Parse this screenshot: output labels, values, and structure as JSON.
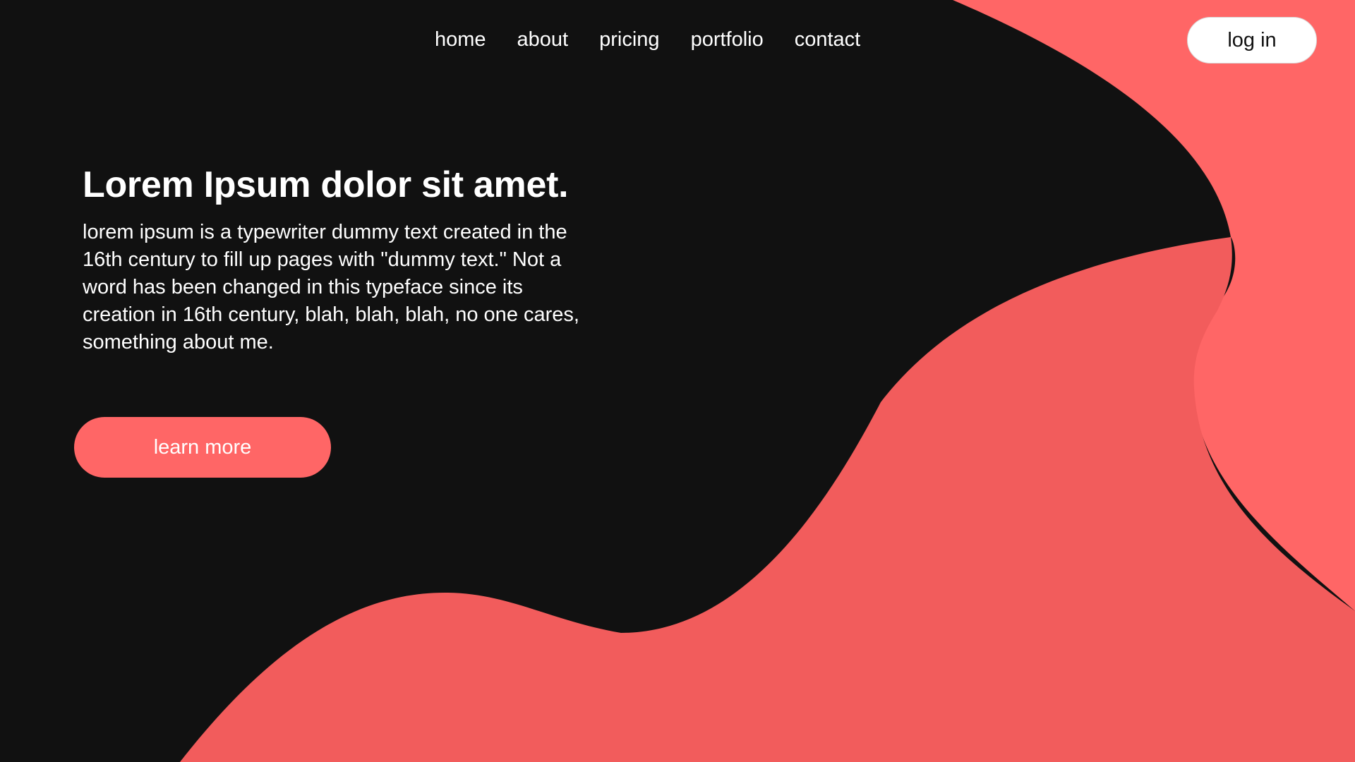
{
  "nav": {
    "items": [
      {
        "label": "home"
      },
      {
        "label": "about"
      },
      {
        "label": "pricing"
      },
      {
        "label": "portfolio"
      },
      {
        "label": "contact"
      }
    ]
  },
  "header": {
    "login_label": "log in"
  },
  "hero": {
    "title": "Lorem Ipsum dolor sit amet.",
    "description": "lorem ipsum is a typewriter dummy text created in the 16th century to fill up pages with \"dummy text.\" Not a word has been changed in this typeface since its creation in 16th century, blah, blah, blah, no one cares, something about me.",
    "cta_label": "learn more"
  },
  "colors": {
    "background": "#111111",
    "accent": "#ff6666",
    "accent_dark": "#f25c5c",
    "text": "#ffffff"
  }
}
